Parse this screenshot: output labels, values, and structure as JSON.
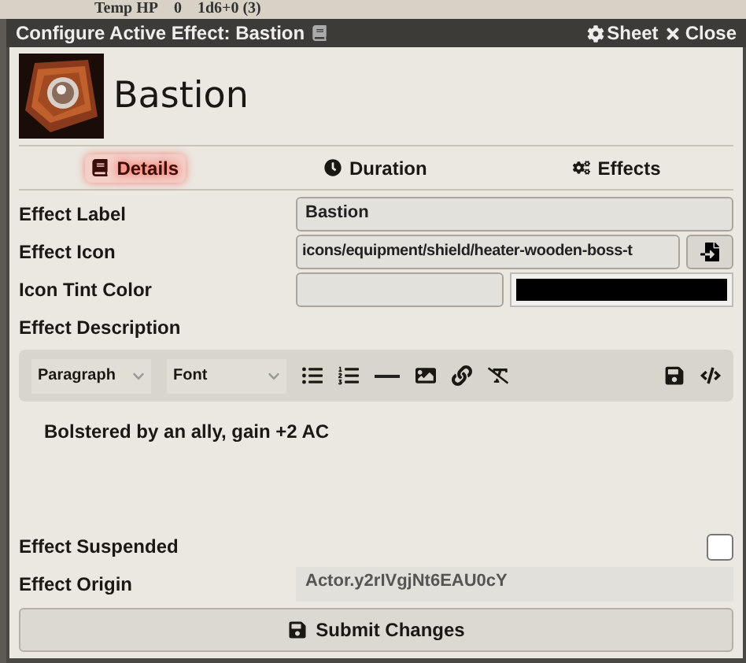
{
  "backdrop": {
    "texts": [
      "Temp HP",
      "0",
      "1d6+0 (3)"
    ]
  },
  "window": {
    "title": "Configure Active Effect: Bastion",
    "buttons": [
      {
        "kind": "sheet",
        "label": "Sheet"
      },
      {
        "kind": "close",
        "label": "Close"
      }
    ]
  },
  "effect": {
    "name": "Bastion"
  },
  "tabs": [
    {
      "kind": "details",
      "label": "Details",
      "selected": true
    },
    {
      "kind": "duration",
      "label": "Duration",
      "selected": false
    },
    {
      "kind": "effects",
      "label": "Effects",
      "selected": false
    }
  ],
  "fields": {
    "label": {
      "label": "Effect Label",
      "value": "Bastion"
    },
    "icon": {
      "label": "Effect Icon",
      "value": "icons/equipment/shield/heater-wooden-boss-t"
    },
    "tint": {
      "label": "Icon Tint Color",
      "color": "#000000"
    },
    "description": {
      "label": "Effect Description",
      "format": "Paragraph",
      "font": "Font",
      "text": "Bolstered by an ally, gain +2 AC"
    },
    "suspended": {
      "label": "Effect Suspended",
      "checked": false
    },
    "origin": {
      "label": "Effect Origin",
      "value": "Actor.y2rIVgjNt6EAU0cY"
    }
  },
  "submit": {
    "label": "Submit Changes"
  }
}
